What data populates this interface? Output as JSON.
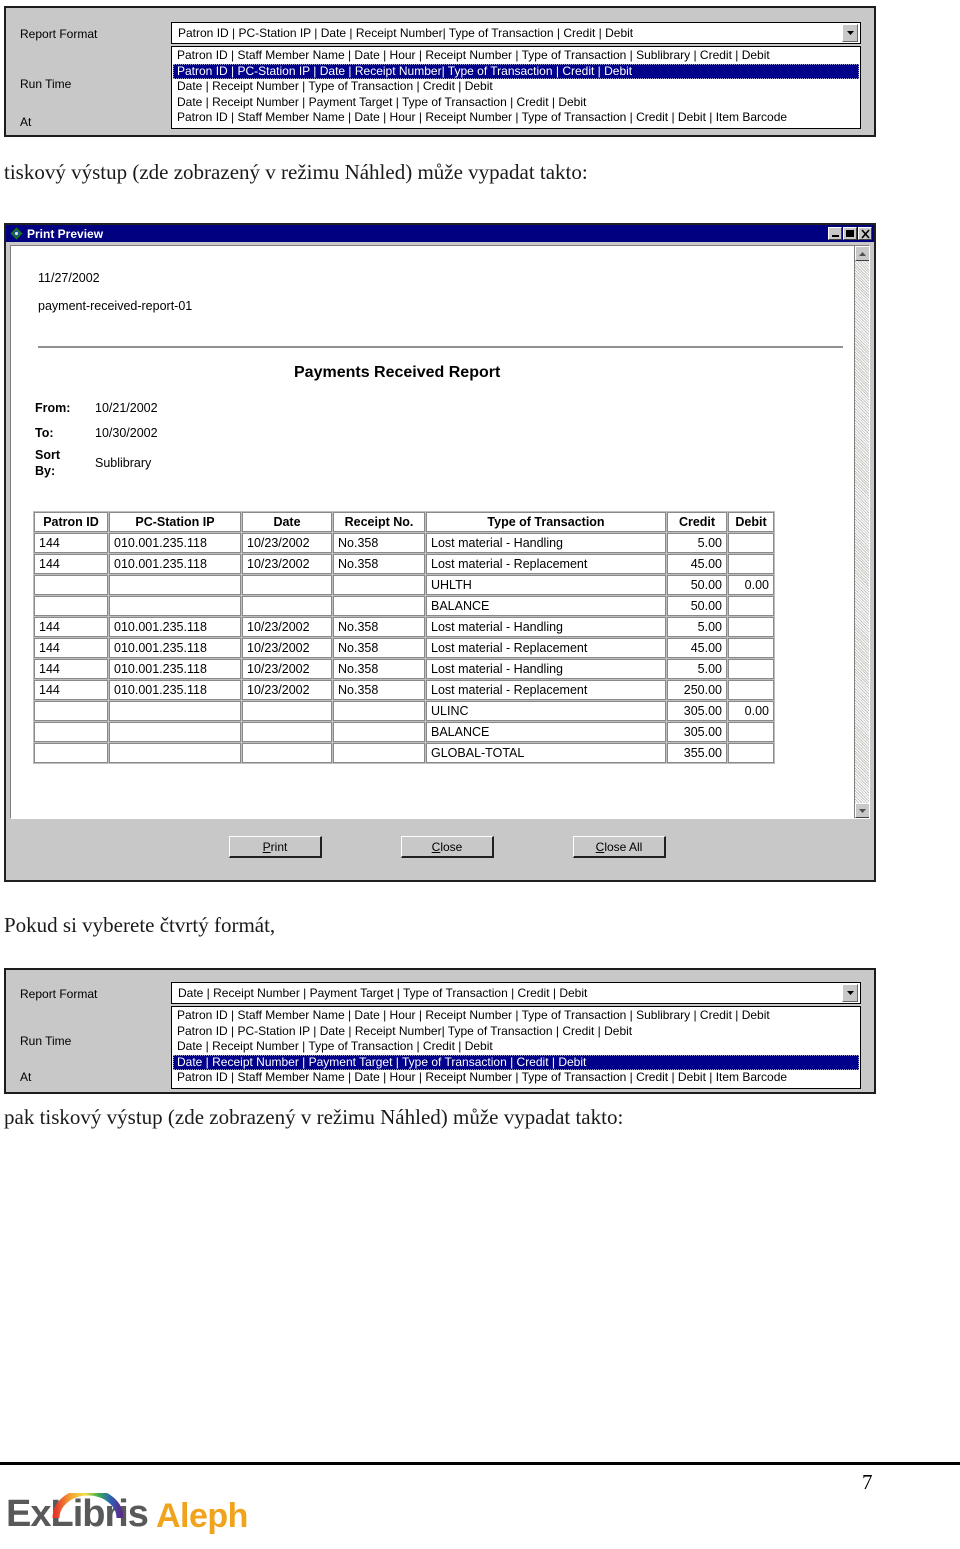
{
  "report_format_panel_top": {
    "labels": {
      "report_format": "Report Format",
      "run_time": "Run Time",
      "at": "At"
    },
    "combo": {
      "value": "Patron ID | PC-Station IP | Date | Receipt Number| Type of Transaction | Credit | Debit",
      "arrow_icon": "chevron-down-icon"
    },
    "options": [
      "Patron ID | Staff Member Name | Date | Hour | Receipt Number | Type of Transaction | Sublibrary | Credit | Debit",
      "Patron ID | PC-Station IP | Date | Receipt Number| Type of Transaction | Credit | Debit",
      "Date | Receipt Number | Type of Transaction | Credit | Debit",
      "Date | Receipt Number | Payment Target | Type of Transaction | Credit | Debit",
      "Patron ID | Staff Member Name | Date | Hour | Receipt Number | Type of Transaction | Credit | Debit | Item Barcode"
    ],
    "selected_index": 1
  },
  "caption_1": "tiskový výstup (zde zobrazený v režimu Náhled) může vypadat takto:",
  "caption_2": "Pokud si vyberete čtvrtý formát,",
  "caption_3": "pak tiskový výstup (zde zobrazený v režimu Náhled) může vypadat takto:",
  "print_preview": {
    "title": "Print Preview",
    "title_icon": "app-diamond-icon",
    "window_buttons": {
      "minimize": "minimize-icon",
      "maximize": "maximize-icon",
      "close": "close-icon"
    },
    "document": {
      "date": "11/27/2002",
      "report_id": "payment-received-report-01",
      "title": "Payments Received Report",
      "from_label": "From:",
      "from_value": "10/21/2002",
      "to_label": "To:",
      "to_value": "10/30/2002",
      "sort_label_line1": "Sort",
      "sort_label_line2": "By:",
      "sort_value": "Sublibrary"
    },
    "table": {
      "columns": [
        "Patron ID",
        "PC-Station IP",
        "Date",
        "Receipt No.",
        "Type of Transaction",
        "Credit",
        "Debit"
      ],
      "rows": [
        [
          "144",
          "010.001.235.118",
          "10/23/2002",
          "No.358",
          "Lost material - Handling",
          "5.00",
          ""
        ],
        [
          "144",
          "010.001.235.118",
          "10/23/2002",
          "No.358",
          "Lost material - Replacement",
          "45.00",
          ""
        ],
        [
          "",
          "",
          "",
          "",
          "UHLTH",
          "50.00",
          "0.00"
        ],
        [
          "",
          "",
          "",
          "",
          "BALANCE",
          "50.00",
          ""
        ],
        [
          "144",
          "010.001.235.118",
          "10/23/2002",
          "No.358",
          "Lost material - Handling",
          "5.00",
          ""
        ],
        [
          "144",
          "010.001.235.118",
          "10/23/2002",
          "No.358",
          "Lost material - Replacement",
          "45.00",
          ""
        ],
        [
          "144",
          "010.001.235.118",
          "10/23/2002",
          "No.358",
          "Lost material - Handling",
          "5.00",
          ""
        ],
        [
          "144",
          "010.001.235.118",
          "10/23/2002",
          "No.358",
          "Lost material - Replacement",
          "250.00",
          ""
        ],
        [
          "",
          "",
          "",
          "",
          "ULINC",
          "305.00",
          "0.00"
        ],
        [
          "",
          "",
          "",
          "",
          "BALANCE",
          "305.00",
          ""
        ],
        [
          "",
          "",
          "",
          "",
          "GLOBAL-TOTAL",
          "355.00",
          ""
        ]
      ]
    },
    "buttons": {
      "print": "Print",
      "close": "Close",
      "close_all": "Close All"
    },
    "scrollbar": {
      "up_icon": "scroll-up-icon",
      "down_icon": "scroll-down-icon"
    }
  },
  "report_format_panel_bottom": {
    "labels": {
      "report_format": "Report Format",
      "run_time": "Run Time",
      "at": "At"
    },
    "combo": {
      "value": "Date | Receipt Number | Payment Target | Type of Transaction | Credit | Debit",
      "arrow_icon": "chevron-down-icon"
    },
    "options": [
      "Patron ID | Staff Member Name | Date | Hour | Receipt Number | Type of Transaction | Sublibrary | Credit | Debit",
      "Patron ID | PC-Station IP | Date | Receipt Number| Type of Transaction | Credit | Debit",
      "Date | Receipt Number | Type of Transaction | Credit | Debit",
      "Date | Receipt Number | Payment Target | Type of Transaction | Credit | Debit",
      "Patron ID | Staff Member Name | Date | Hour | Receipt Number | Type of Transaction | Credit | Debit | Item Barcode"
    ],
    "selected_index": 3
  },
  "footer": {
    "page_number": "7",
    "logo_primary": "ExLibris",
    "logo_secondary": "Aleph"
  },
  "colors": {
    "titlebar": "#000080",
    "selection": "#00008B",
    "window_face": "#c8c8c8",
    "logo_gray": "#58595b",
    "logo_orange": "#f0a41e"
  }
}
